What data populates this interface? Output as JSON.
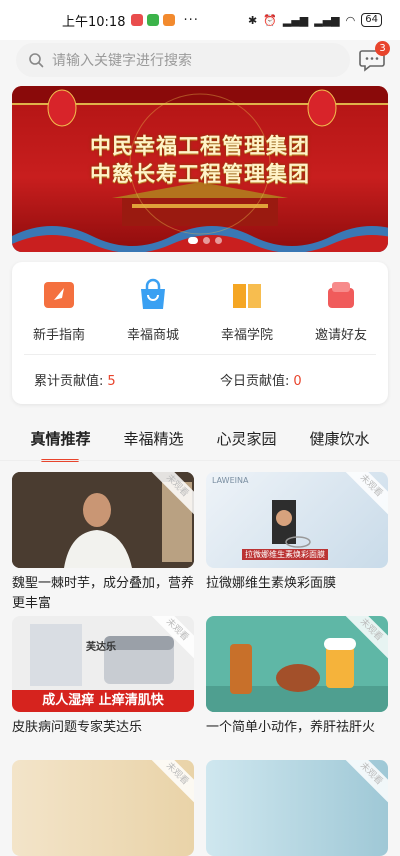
{
  "status": {
    "time": "上午10:18",
    "more": "···",
    "battery": "64"
  },
  "search": {
    "placeholder": "请输入关键字进行搜索"
  },
  "messages": {
    "badge": "3"
  },
  "banner": {
    "line1": "中民幸福工程管理集团",
    "line2": "中慈长寿工程管理集团"
  },
  "menu": [
    {
      "label": "新手指南",
      "icon": "guide-icon",
      "color": "#f4703f"
    },
    {
      "label": "幸福商城",
      "icon": "shopping-bag-icon",
      "color": "#3aa0f2"
    },
    {
      "label": "幸福学院",
      "icon": "book-icon",
      "color": "#f5a623"
    },
    {
      "label": "邀请好友",
      "icon": "gift-icon",
      "color": "#f05b5b"
    }
  ],
  "contribution": {
    "total_label": "累计贡献值:",
    "total_value": "5",
    "today_label": "今日贡献值:",
    "today_value": "0"
  },
  "tabs": [
    "真情推荐",
    "幸福精选",
    "心灵家园",
    "健康饮水"
  ],
  "articles": [
    {
      "title": "魏聖一棘时芋，成分叠加，营养更丰富",
      "watermark": "未观看"
    },
    {
      "title": "拉微娜维生素焕彩面膜",
      "watermark": "未观看",
      "brand": "LAWEINA",
      "caption": "拉微娜维生素焕彩面膜"
    },
    {
      "title": "皮肤病问题专家芙达乐",
      "watermark": "未观看",
      "banner_text": "成人湿痒 止痒清肌快",
      "product": "芙达乐"
    },
    {
      "title": "一个简单小动作，养肝祛肝火",
      "watermark": "未观看"
    },
    {
      "title": "",
      "watermark": "未观看"
    },
    {
      "title": "",
      "watermark": "未观看"
    }
  ],
  "colors": {
    "accent": "#e8442c",
    "banner_red": "#c81e1e"
  }
}
